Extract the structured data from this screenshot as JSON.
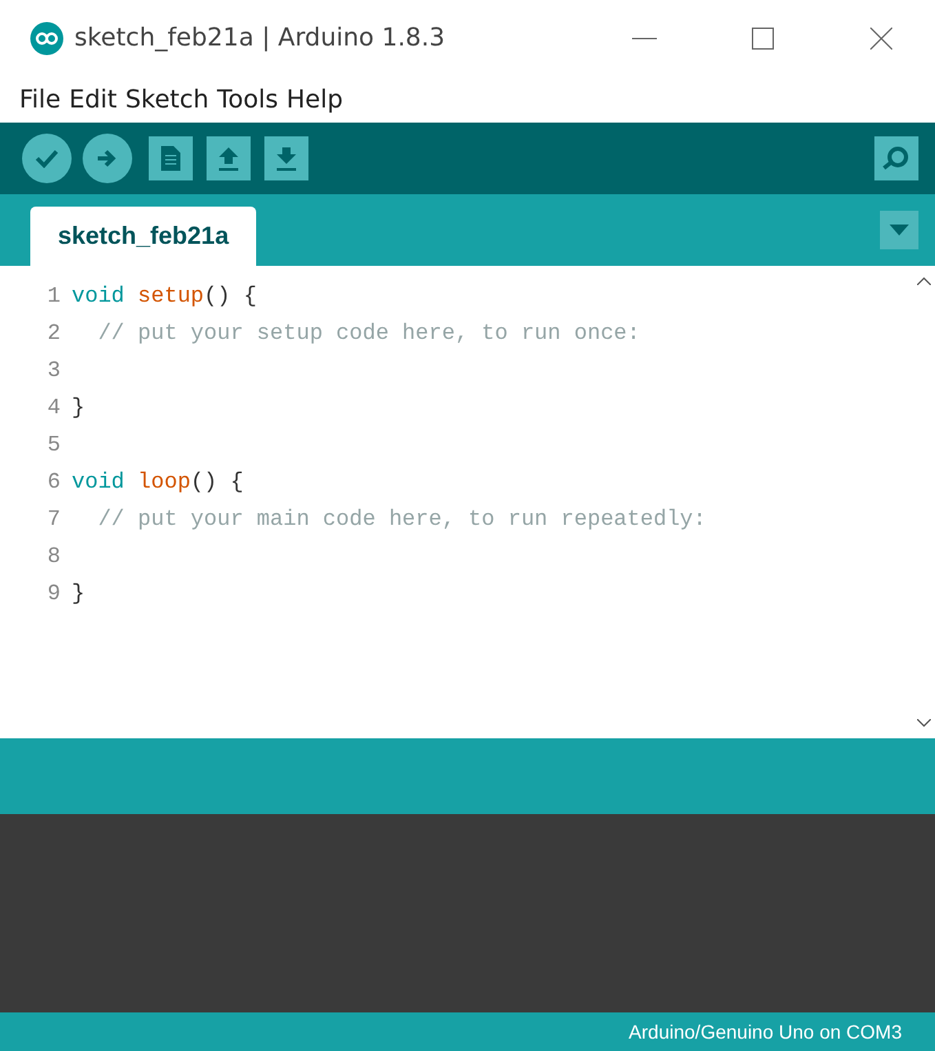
{
  "window": {
    "title": "sketch_feb21a | Arduino 1.8.3"
  },
  "menu": [
    "File",
    "Edit",
    "Sketch",
    "Tools",
    "Help"
  ],
  "toolbar": [
    {
      "kind": "verify"
    },
    {
      "kind": "upload"
    },
    {
      "kind": "new"
    },
    {
      "kind": "open"
    },
    {
      "kind": "save"
    }
  ],
  "tabs": [
    {
      "label": "sketch_feb21a",
      "selected": true
    }
  ],
  "editor": {
    "lines": [
      {
        "number": "1",
        "tokens": [
          {
            "kind": "type",
            "text": "void"
          },
          {
            "kind": "function",
            "text": " setup"
          },
          {
            "kind": "plain",
            "text": "() {"
          }
        ]
      },
      {
        "number": "2",
        "tokens": [
          {
            "kind": "comment",
            "text": "  // put your setup code here, to run once:"
          }
        ]
      },
      {
        "number": "3"
      },
      {
        "number": "4",
        "tokens": [
          {
            "kind": "plain",
            "text": "}"
          }
        ]
      },
      {
        "number": "5"
      },
      {
        "number": "6",
        "tokens": [
          {
            "kind": "type",
            "text": "void"
          },
          {
            "kind": "function",
            "text": " loop"
          },
          {
            "kind": "plain",
            "text": "() {"
          }
        ]
      },
      {
        "number": "7",
        "tokens": [
          {
            "kind": "comment",
            "text": "  // put your main code here, to run repeatedly:"
          }
        ]
      },
      {
        "number": "8"
      },
      {
        "number": "9",
        "tokens": [
          {
            "kind": "plain",
            "text": "}"
          }
        ]
      }
    ]
  },
  "status_bar": {
    "board": "Arduino/Genuino Uno on COM3"
  }
}
